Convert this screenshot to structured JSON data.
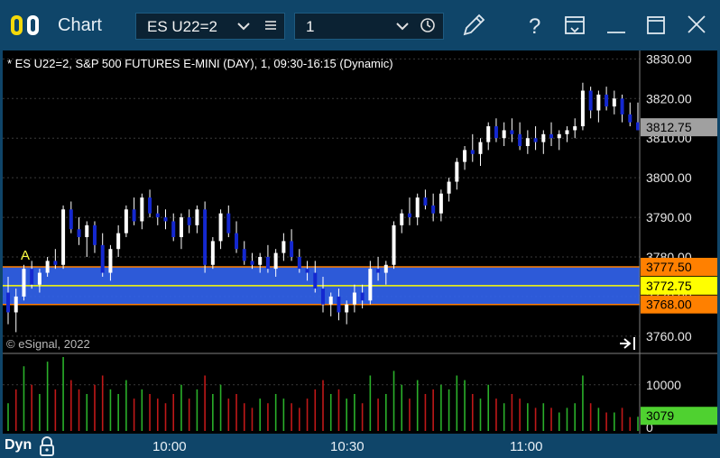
{
  "window": {
    "title": "Chart",
    "symbol": "ES U22=2",
    "interval": "1",
    "footer_mode": "Dyn"
  },
  "icons": {
    "logo": "esignal-logo-icon",
    "symbol_dropdown": "chevron-down-icon",
    "symbol_list": "list-icon",
    "interval_dropdown": "chevron-down-icon",
    "interval_clock": "clock-icon",
    "edit": "pencil-icon",
    "help": "question-icon",
    "save": "save-window-icon",
    "minimize": "minimize-icon",
    "maximize": "maximize-icon",
    "close": "close-icon",
    "lock": "lock-icon",
    "scroll_end": "scroll-to-end-icon"
  },
  "chart_data": {
    "type": "candlestick",
    "title": "* ES U22=2, S&P 500 FUTURES E-MINI (DAY), 1, 09:30-16:15 (Dynamic)",
    "watermark": "© eSignal, 2022",
    "marker_label": "A",
    "price_axis": {
      "ticks": [
        "3830.00",
        "3820.00",
        "3810.00",
        "3800.00",
        "3790.00",
        "3780.00",
        "3770.00",
        "3760.00"
      ],
      "ylim": [
        3757,
        3831
      ]
    },
    "time_axis": {
      "ticks": [
        "10:00",
        "10:30",
        "11:00"
      ]
    },
    "price_labels": [
      {
        "value": 3812.75,
        "text": "3812.75",
        "color": "#a0a0a0"
      },
      {
        "value": 3777.5,
        "text": "3777.50",
        "color": "#ff8000"
      },
      {
        "value": 3772.75,
        "text": "3772.75",
        "color": "#ffff00"
      },
      {
        "value": 3768.0,
        "text": "3768.00",
        "color": "#ff8000"
      }
    ],
    "zone": {
      "top": 3777.5,
      "mid": 3772.75,
      "bottom": 3768.0,
      "fill": "#3264f0"
    },
    "colors": {
      "up": "#ffffff",
      "down": "#1428d0",
      "vol_up": "#2ab02a",
      "vol_down": "#c01818"
    },
    "ohlc": [
      [
        3771,
        3775,
        3763,
        3766
      ],
      [
        3766,
        3772,
        3761,
        3770
      ],
      [
        3770,
        3778,
        3769,
        3777
      ],
      [
        3777,
        3779,
        3772,
        3773
      ],
      [
        3773,
        3777,
        3771,
        3776
      ],
      [
        3776,
        3780,
        3775,
        3779
      ],
      [
        3779,
        3782,
        3777,
        3778
      ],
      [
        3778,
        3793,
        3777,
        3792
      ],
      [
        3792,
        3794,
        3786,
        3787
      ],
      [
        3787,
        3790,
        3783,
        3785
      ],
      [
        3785,
        3789,
        3780,
        3788
      ],
      [
        3788,
        3789,
        3781,
        3783
      ],
      [
        3783,
        3786,
        3775,
        3776
      ],
      [
        3776,
        3783,
        3774,
        3782
      ],
      [
        3782,
        3788,
        3780,
        3786
      ],
      [
        3786,
        3793,
        3785,
        3792
      ],
      [
        3792,
        3795,
        3788,
        3789
      ],
      [
        3789,
        3796,
        3787,
        3795
      ],
      [
        3795,
        3797,
        3790,
        3791
      ],
      [
        3791,
        3793,
        3788,
        3790
      ],
      [
        3790,
        3792,
        3787,
        3789
      ],
      [
        3789,
        3791,
        3784,
        3785
      ],
      [
        3785,
        3791,
        3782,
        3790
      ],
      [
        3790,
        3792,
        3786,
        3788
      ],
      [
        3788,
        3793,
        3786,
        3792
      ],
      [
        3792,
        3794,
        3776,
        3778
      ],
      [
        3778,
        3785,
        3777,
        3784
      ],
      [
        3784,
        3792,
        3782,
        3791
      ],
      [
        3791,
        3793,
        3785,
        3786
      ],
      [
        3786,
        3789,
        3781,
        3782
      ],
      [
        3782,
        3784,
        3778,
        3779
      ],
      [
        3779,
        3781,
        3777,
        3778
      ],
      [
        3778,
        3781,
        3776,
        3780
      ],
      [
        3780,
        3783,
        3776,
        3777
      ],
      [
        3777,
        3782,
        3775,
        3781
      ],
      [
        3781,
        3786,
        3779,
        3784
      ],
      [
        3784,
        3787,
        3779,
        3780
      ],
      [
        3780,
        3782,
        3776,
        3777
      ],
      [
        3777,
        3779,
        3774,
        3776
      ],
      [
        3776,
        3779,
        3771,
        3772
      ],
      [
        3772,
        3775,
        3766,
        3768
      ],
      [
        3768,
        3771,
        3765,
        3770
      ],
      [
        3770,
        3772,
        3764,
        3766
      ],
      [
        3766,
        3769,
        3763,
        3768
      ],
      [
        3768,
        3773,
        3766,
        3771
      ],
      [
        3771,
        3773,
        3767,
        3769
      ],
      [
        3769,
        3779,
        3768,
        3777
      ],
      [
        3777,
        3780,
        3774,
        3776
      ],
      [
        3776,
        3779,
        3773,
        3778
      ],
      [
        3778,
        3789,
        3777,
        3788
      ],
      [
        3788,
        3792,
        3786,
        3791
      ],
      [
        3791,
        3795,
        3788,
        3790
      ],
      [
        3790,
        3796,
        3788,
        3795
      ],
      [
        3795,
        3797,
        3792,
        3793
      ],
      [
        3793,
        3796,
        3789,
        3791
      ],
      [
        3791,
        3797,
        3789,
        3796
      ],
      [
        3796,
        3800,
        3794,
        3799
      ],
      [
        3799,
        3805,
        3797,
        3804
      ],
      [
        3804,
        3808,
        3802,
        3807
      ],
      [
        3807,
        3811,
        3804,
        3806
      ],
      [
        3806,
        3810,
        3803,
        3809
      ],
      [
        3809,
        3814,
        3807,
        3813
      ],
      [
        3813,
        3815,
        3809,
        3810
      ],
      [
        3810,
        3814,
        3808,
        3812
      ],
      [
        3812,
        3815,
        3809,
        3811
      ],
      [
        3811,
        3814,
        3807,
        3808
      ],
      [
        3808,
        3812,
        3806,
        3810
      ],
      [
        3810,
        3813,
        3807,
        3809
      ],
      [
        3809,
        3812,
        3806,
        3811
      ],
      [
        3811,
        3814,
        3808,
        3810
      ],
      [
        3810,
        3812,
        3807,
        3811
      ],
      [
        3811,
        3813,
        3809,
        3812
      ],
      [
        3812,
        3815,
        3810,
        3813
      ],
      [
        3813,
        3824,
        3812,
        3822
      ],
      [
        3822,
        3823,
        3815,
        3817
      ],
      [
        3817,
        3822,
        3814,
        3821
      ],
      [
        3821,
        3823,
        3817,
        3818
      ],
      [
        3818,
        3822,
        3816,
        3820
      ],
      [
        3820,
        3821,
        3814,
        3816
      ],
      [
        3816,
        3819,
        3813,
        3814
      ],
      [
        3814,
        3819,
        3812,
        3812
      ]
    ],
    "volume_axis": {
      "ticks": [
        "10000",
        "0"
      ],
      "ylim": [
        0,
        16000
      ]
    },
    "volume_label": {
      "text": "3079",
      "value": 3079,
      "color": "#4fd130"
    },
    "volume": [
      [
        6000,
        1
      ],
      [
        9000,
        0
      ],
      [
        14000,
        1
      ],
      [
        10000,
        0
      ],
      [
        8000,
        1
      ],
      [
        15000,
        1
      ],
      [
        9000,
        0
      ],
      [
        16000,
        1
      ],
      [
        11000,
        0
      ],
      [
        9000,
        0
      ],
      [
        8000,
        1
      ],
      [
        10000,
        0
      ],
      [
        12000,
        0
      ],
      [
        9000,
        1
      ],
      [
        8000,
        1
      ],
      [
        11000,
        1
      ],
      [
        7000,
        0
      ],
      [
        9000,
        1
      ],
      [
        8000,
        0
      ],
      [
        7000,
        0
      ],
      [
        6000,
        0
      ],
      [
        8000,
        0
      ],
      [
        10000,
        1
      ],
      [
        7000,
        0
      ],
      [
        9000,
        1
      ],
      [
        12000,
        0
      ],
      [
        8000,
        1
      ],
      [
        10000,
        1
      ],
      [
        7000,
        0
      ],
      [
        8000,
        0
      ],
      [
        6000,
        0
      ],
      [
        5000,
        0
      ],
      [
        7000,
        1
      ],
      [
        6000,
        0
      ],
      [
        8000,
        1
      ],
      [
        7000,
        1
      ],
      [
        6000,
        0
      ],
      [
        5000,
        0
      ],
      [
        7000,
        0
      ],
      [
        9000,
        0
      ],
      [
        11000,
        0
      ],
      [
        8000,
        1
      ],
      [
        9000,
        0
      ],
      [
        7000,
        1
      ],
      [
        8000,
        1
      ],
      [
        6000,
        0
      ],
      [
        12000,
        1
      ],
      [
        7000,
        0
      ],
      [
        8000,
        1
      ],
      [
        13000,
        1
      ],
      [
        10000,
        1
      ],
      [
        7000,
        0
      ],
      [
        11000,
        1
      ],
      [
        8000,
        0
      ],
      [
        9000,
        0
      ],
      [
        10000,
        1
      ],
      [
        9000,
        1
      ],
      [
        12000,
        1
      ],
      [
        11000,
        1
      ],
      [
        8000,
        0
      ],
      [
        7000,
        1
      ],
      [
        10000,
        1
      ],
      [
        7000,
        0
      ],
      [
        6000,
        1
      ],
      [
        8000,
        0
      ],
      [
        7000,
        0
      ],
      [
        6000,
        1
      ],
      [
        5000,
        0
      ],
      [
        6000,
        1
      ],
      [
        5000,
        0
      ],
      [
        4000,
        1
      ],
      [
        5000,
        1
      ],
      [
        6000,
        1
      ],
      [
        12000,
        1
      ],
      [
        6000,
        0
      ],
      [
        5000,
        1
      ],
      [
        4000,
        0
      ],
      [
        4000,
        1
      ],
      [
        5000,
        0
      ],
      [
        3000,
        0
      ],
      [
        3079,
        1
      ]
    ]
  }
}
